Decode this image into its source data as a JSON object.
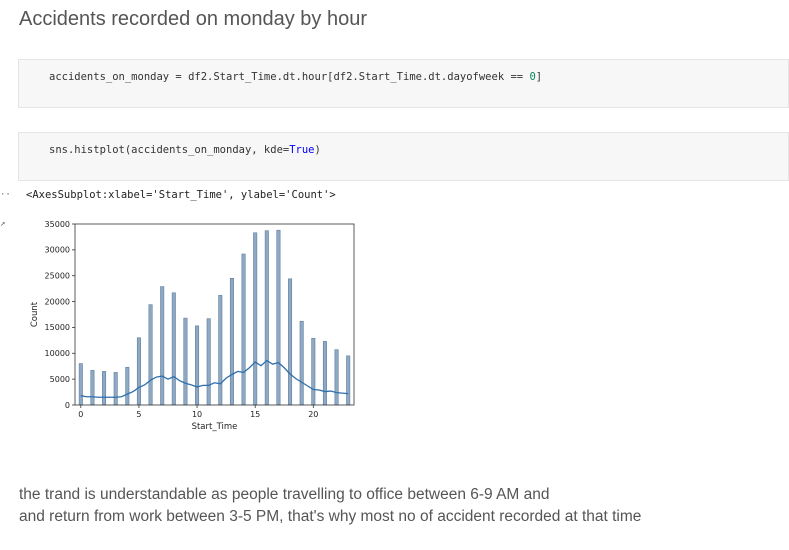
{
  "markdown": {
    "heading": "Accidents recorded on monday by hour",
    "note_line1": "the trand is understandable as people travelling to office between 6-9 AM and",
    "note_line2": "and return from work between 3-5 PM, that's why most no of accident recorded at that time"
  },
  "cells": {
    "cell1": {
      "code_pre": "accidents_on_monday = df2.Start_Time.dt.hour[df2.Start_Time.dt.dayofweek == ",
      "code_num": "0",
      "code_post": "]"
    },
    "cell2": {
      "code_pre": "sns.histplot(accidents_on_monday, kde=",
      "code_kw": "True",
      "code_post": ")"
    }
  },
  "output": {
    "prompt_dots": "··",
    "prompt_arrow": "↗",
    "repr_text": "<AxesSubplot:xlabel='Start_Time', ylabel='Count'>"
  },
  "colors": {
    "bar_fill": "#8fa9c4",
    "bar_edge": "#5f7f9f",
    "kde_line": "#2f6fad",
    "axis": "#333333"
  },
  "chart_data": {
    "type": "bar",
    "title": "",
    "xlabel": "Start_Time",
    "ylabel": "Count",
    "xlim": [
      -0.5,
      23.5
    ],
    "ylim": [
      0,
      35000
    ],
    "x_ticks": [
      0,
      5,
      10,
      15,
      20
    ],
    "x_tick_labels": [
      "0",
      "5",
      "10",
      "15",
      "20"
    ],
    "y_ticks": [
      0,
      5000,
      10000,
      15000,
      20000,
      25000,
      30000,
      35000
    ],
    "y_tick_labels": [
      "0",
      "5000",
      "10000",
      "15000",
      "20000",
      "25000",
      "30000",
      "35000"
    ],
    "hours": [
      0,
      1,
      2,
      3,
      4,
      5,
      6,
      7,
      8,
      9,
      10,
      11,
      12,
      13,
      14,
      15,
      16,
      17,
      18,
      19,
      20,
      21,
      22,
      23
    ],
    "counts": [
      8000,
      6700,
      6500,
      6300,
      7300,
      13000,
      19400,
      22900,
      21700,
      16800,
      15300,
      16700,
      21200,
      24500,
      29200,
      33300,
      33700,
      33800,
      24400,
      16200,
      12900,
      12300,
      10700,
      9500
    ],
    "kde": {
      "x": [
        0,
        0.5,
        1,
        1.5,
        2,
        2.5,
        3,
        3.5,
        4,
        4.5,
        5,
        5.5,
        6,
        6.5,
        7,
        7.5,
        8,
        8.5,
        9,
        9.5,
        10,
        10.5,
        11,
        11.5,
        12,
        12.5,
        13,
        13.5,
        14,
        14.5,
        15,
        15.5,
        16,
        16.5,
        17,
        17.5,
        18,
        18.5,
        19,
        19.5,
        20,
        20.5,
        21,
        21.5,
        22,
        22.5,
        23
      ],
      "y": [
        1800,
        1600,
        1600,
        1500,
        1500,
        1500,
        1500,
        1600,
        2100,
        2600,
        3400,
        3900,
        4800,
        5400,
        5600,
        5000,
        5500,
        4700,
        4200,
        3900,
        3500,
        3800,
        3800,
        4300,
        4100,
        5200,
        5900,
        6500,
        6300,
        7200,
        8300,
        7600,
        8600,
        7900,
        8200,
        7200,
        6000,
        5100,
        4400,
        3700,
        3000,
        2900,
        2600,
        2700,
        2400,
        2300,
        2200
      ]
    }
  }
}
